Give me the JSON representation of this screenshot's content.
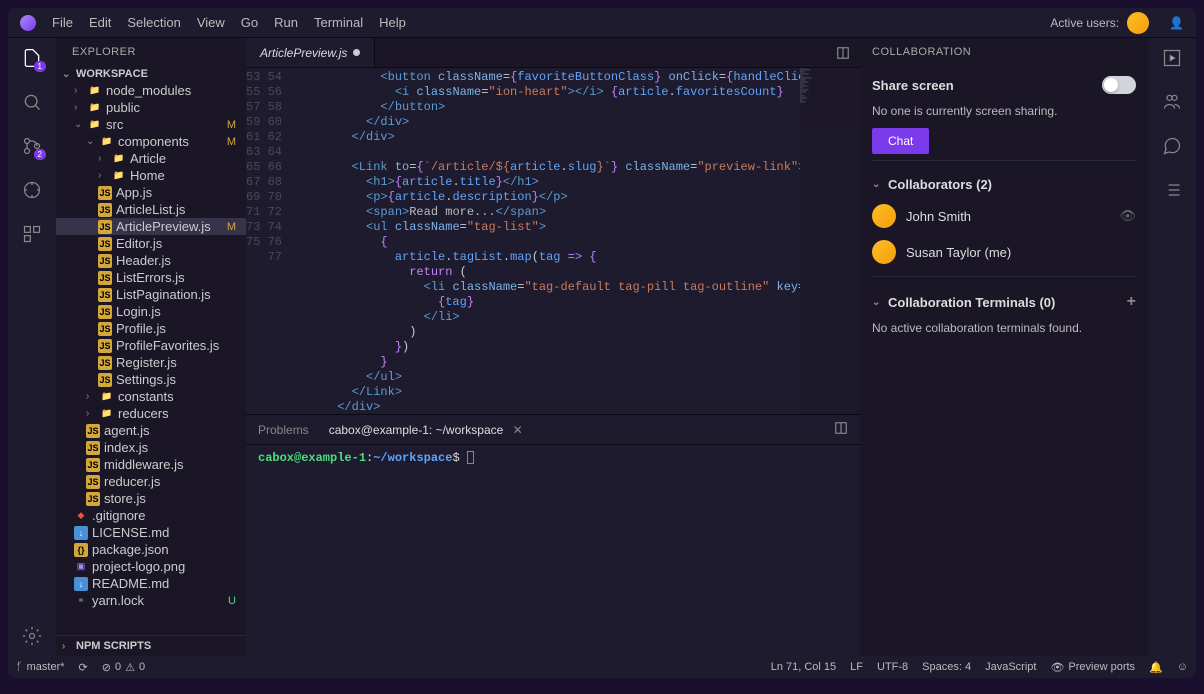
{
  "menu": [
    "File",
    "Edit",
    "Selection",
    "View",
    "Go",
    "Run",
    "Terminal",
    "Help"
  ],
  "titlebar": {
    "active_users_label": "Active users:"
  },
  "sidebar": {
    "title": "EXPLORER",
    "workspace": "WORKSPACE",
    "tree": [
      {
        "name": "node_modules",
        "type": "folder",
        "depth": 1,
        "chev": "›"
      },
      {
        "name": "public",
        "type": "folder",
        "depth": 1,
        "chev": "›"
      },
      {
        "name": "src",
        "type": "folder",
        "depth": 1,
        "chev": "⌄",
        "status": "M"
      },
      {
        "name": "components",
        "type": "folder",
        "depth": 2,
        "chev": "⌄",
        "status": "M"
      },
      {
        "name": "Article",
        "type": "folder",
        "depth": 3,
        "chev": "›"
      },
      {
        "name": "Home",
        "type": "folder",
        "depth": 3,
        "chev": "›"
      },
      {
        "name": "App.js",
        "type": "js",
        "depth": 3
      },
      {
        "name": "ArticleList.js",
        "type": "js",
        "depth": 3
      },
      {
        "name": "ArticlePreview.js",
        "type": "js",
        "depth": 3,
        "selected": true,
        "status": "M"
      },
      {
        "name": "Editor.js",
        "type": "js",
        "depth": 3
      },
      {
        "name": "Header.js",
        "type": "js",
        "depth": 3
      },
      {
        "name": "ListErrors.js",
        "type": "js",
        "depth": 3
      },
      {
        "name": "ListPagination.js",
        "type": "js",
        "depth": 3
      },
      {
        "name": "Login.js",
        "type": "js",
        "depth": 3
      },
      {
        "name": "Profile.js",
        "type": "js",
        "depth": 3
      },
      {
        "name": "ProfileFavorites.js",
        "type": "js",
        "depth": 3
      },
      {
        "name": "Register.js",
        "type": "js",
        "depth": 3
      },
      {
        "name": "Settings.js",
        "type": "js",
        "depth": 3
      },
      {
        "name": "constants",
        "type": "folder",
        "depth": 2,
        "chev": "›"
      },
      {
        "name": "reducers",
        "type": "folder",
        "depth": 2,
        "chev": "›"
      },
      {
        "name": "agent.js",
        "type": "js",
        "depth": 2
      },
      {
        "name": "index.js",
        "type": "js",
        "depth": 2
      },
      {
        "name": "middleware.js",
        "type": "js",
        "depth": 2
      },
      {
        "name": "reducer.js",
        "type": "js",
        "depth": 2
      },
      {
        "name": "store.js",
        "type": "js",
        "depth": 2
      },
      {
        "name": ".gitignore",
        "type": "git",
        "depth": 1
      },
      {
        "name": "LICENSE.md",
        "type": "md",
        "depth": 1
      },
      {
        "name": "package.json",
        "type": "json",
        "depth": 1
      },
      {
        "name": "project-logo.png",
        "type": "img",
        "depth": 1
      },
      {
        "name": "README.md",
        "type": "md",
        "depth": 1
      },
      {
        "name": "yarn.lock",
        "type": "lock",
        "depth": 1,
        "status": "U",
        "statusClass": "u"
      }
    ],
    "npm_scripts": "NPM SCRIPTS"
  },
  "editor": {
    "tab": "ArticlePreview.js",
    "lines_start": 53,
    "lines_end": 77,
    "prompt_user": "cabox@example-1",
    "prompt_path": "~/workspace",
    "panel_tabs": {
      "problems": "Problems",
      "terminal": "cabox@example-1: ~/workspace"
    }
  },
  "collab": {
    "title": "COLLABORATION",
    "share": "Share screen",
    "noone": "No one is currently screen sharing.",
    "chat": "Chat",
    "collaborators": "Collaborators (2)",
    "users": [
      {
        "name": "John Smith"
      },
      {
        "name": "Susan Taylor (me)"
      }
    ],
    "terminals": "Collaboration Terminals (0)",
    "no_terminals": "No active collaboration terminals found."
  },
  "statusbar": {
    "branch": "master*",
    "sync": "⟳",
    "errors": "0",
    "warnings": "0",
    "lncol": "Ln 71, Col 15",
    "eol": "LF",
    "encoding": "UTF-8",
    "spaces": "Spaces: 4",
    "lang": "JavaScript",
    "preview": "Preview ports"
  }
}
